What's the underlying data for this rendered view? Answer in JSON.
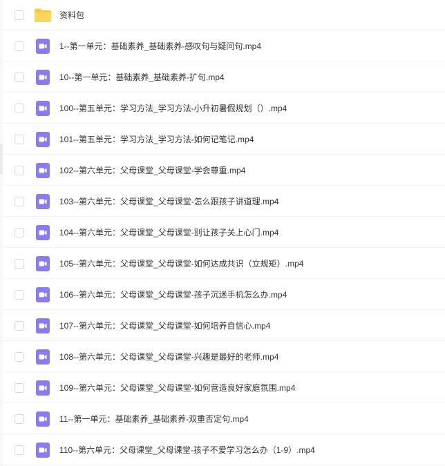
{
  "colors": {
    "folder_yellow": "#ffc93a",
    "video_purple": "#8b7bf0",
    "text": "#333333"
  },
  "files": [
    {
      "name": "资料包",
      "type": "folder",
      "icon": "folder-icon"
    },
    {
      "name": "1--第一单元：基础素养_基础素养-感叹句与疑问句.mp4",
      "type": "video",
      "icon": "video-file-icon"
    },
    {
      "name": "10--第一单元：基础素养_基础素养-扩句.mp4",
      "type": "video",
      "icon": "video-file-icon"
    },
    {
      "name": "100--第五单元：学习方法_学习方法-小升初暑假规划（）.mp4",
      "type": "video",
      "icon": "video-file-icon"
    },
    {
      "name": "101--第五单元：学习方法_学习方法-如何记笔记.mp4",
      "type": "video",
      "icon": "video-file-icon"
    },
    {
      "name": "102--第六单元：父母课堂_父母课堂-学会尊重.mp4",
      "type": "video",
      "icon": "video-file-icon"
    },
    {
      "name": "103--第六单元：父母课堂_父母课堂-怎么跟孩子讲道理.mp4",
      "type": "video",
      "icon": "video-file-icon"
    },
    {
      "name": "104--第六单元：父母课堂_父母课堂-别让孩子关上心门.mp4",
      "type": "video",
      "icon": "video-file-icon"
    },
    {
      "name": "105--第六单元：父母课堂_父母课堂-如何达成共识（立规矩）.mp4",
      "type": "video",
      "icon": "video-file-icon"
    },
    {
      "name": "106--第六单元：父母课堂_父母课堂-孩子沉迷手机怎么办.mp4",
      "type": "video",
      "icon": "video-file-icon"
    },
    {
      "name": "107--第六单元：父母课堂_父母课堂-如何培养自信心.mp4",
      "type": "video",
      "icon": "video-file-icon"
    },
    {
      "name": "108--第六单元：父母课堂_父母课堂-兴趣是最好的老师.mp4",
      "type": "video",
      "icon": "video-file-icon"
    },
    {
      "name": "109--第六单元：父母课堂_父母课堂-如何营造良好家庭氛围.mp4",
      "type": "video",
      "icon": "video-file-icon"
    },
    {
      "name": "11--第一单元：基础素养_基础素养-双重否定句.mp4",
      "type": "video",
      "icon": "video-file-icon"
    },
    {
      "name": "110--第六单元：父母课堂_父母课堂-孩子不爱学习怎么办（1-9）.mp4",
      "type": "video",
      "icon": "video-file-icon"
    }
  ]
}
